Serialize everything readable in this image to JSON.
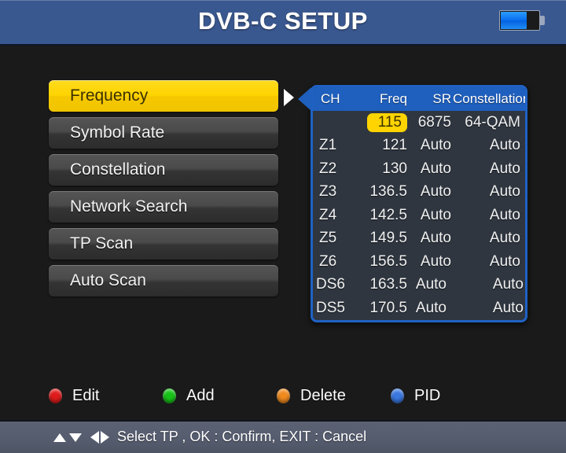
{
  "header": {
    "title": "DVB-C SETUP",
    "battery": {
      "icon": "battery-icon",
      "level_percent": 65
    }
  },
  "menu": {
    "items": [
      {
        "label": "Frequency",
        "selected": true
      },
      {
        "label": "Symbol Rate",
        "selected": false
      },
      {
        "label": "Constellation",
        "selected": false
      },
      {
        "label": "Network Search",
        "selected": false
      },
      {
        "label": "TP Scan",
        "selected": false
      },
      {
        "label": "Auto Scan",
        "selected": false
      }
    ],
    "arrow_icon": "chevron-right-icon"
  },
  "tp_table": {
    "columns": [
      "CH",
      "Freq",
      "SR",
      "Constellation"
    ],
    "rows": [
      {
        "ch": "",
        "freq": "115",
        "sr": "6875",
        "constellation": "64-QAM",
        "highlighted": true,
        "indented": false
      },
      {
        "ch": "Z1",
        "freq": "121",
        "sr": "Auto",
        "constellation": "Auto",
        "highlighted": false,
        "indented": false
      },
      {
        "ch": "Z2",
        "freq": "130",
        "sr": "Auto",
        "constellation": "Auto",
        "highlighted": false,
        "indented": false
      },
      {
        "ch": "Z3",
        "freq": "136.5",
        "sr": "Auto",
        "constellation": "Auto",
        "highlighted": false,
        "indented": false
      },
      {
        "ch": "Z4",
        "freq": "142.5",
        "sr": "Auto",
        "constellation": "Auto",
        "highlighted": false,
        "indented": false
      },
      {
        "ch": "Z5",
        "freq": "149.5",
        "sr": "Auto",
        "constellation": "Auto",
        "highlighted": false,
        "indented": false
      },
      {
        "ch": "Z6",
        "freq": "156.5",
        "sr": "Auto",
        "constellation": "Auto",
        "highlighted": false,
        "indented": false
      },
      {
        "ch": "DS6",
        "freq": "163.5",
        "sr": "Auto",
        "constellation": "Auto",
        "highlighted": false,
        "indented": true
      },
      {
        "ch": "DS5",
        "freq": "170.5",
        "sr": "Auto",
        "constellation": "Auto",
        "highlighted": false,
        "indented": true
      }
    ]
  },
  "legend": {
    "items": [
      {
        "label": "Edit",
        "color": "#e01b1b",
        "icon": "red-dot-icon"
      },
      {
        "label": "Add",
        "color": "#17c217",
        "icon": "green-dot-icon"
      },
      {
        "label": "Delete",
        "color": "#f08a1e",
        "icon": "orange-dot-icon"
      },
      {
        "label": "PID",
        "color": "#3a78e0",
        "icon": "blue-dot-icon"
      }
    ]
  },
  "statusbar": {
    "hint": "Select TP ,  OK : Confirm,  EXIT : Cancel",
    "icons": [
      "arrow-up-icon",
      "arrow-down-icon",
      "arrow-left-icon",
      "arrow-right-icon"
    ]
  },
  "colors": {
    "accent_yellow": "#ffd400",
    "panel_blue": "#1f5fbd",
    "panel_border": "#1f62c4",
    "background": "#1a1a1a",
    "titlebar_blue": "#3a5890"
  }
}
